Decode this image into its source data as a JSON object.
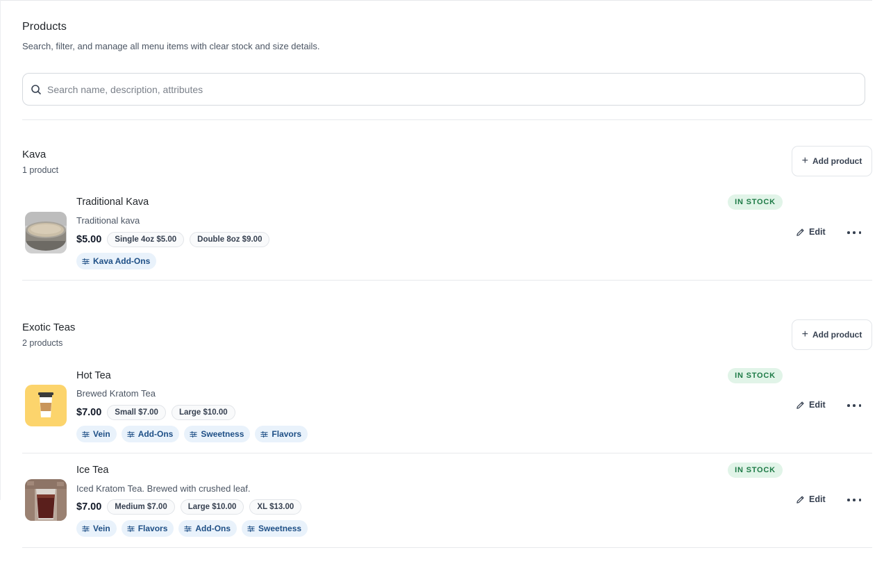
{
  "page": {
    "title": "Products",
    "subtitle": "Search, filter, and manage all menu items with clear stock and size details."
  },
  "search": {
    "placeholder": "Search name, description, attributes",
    "value": ""
  },
  "categories": [
    {
      "name": "Kava",
      "count": "1 product",
      "add_label": "Add product",
      "products": [
        {
          "name": "Traditional Kava",
          "description": "Traditional kava",
          "price": "$5.00",
          "sizes": [
            "Single 4oz $5.00",
            "Double 8oz $9.00"
          ],
          "modifiers": [
            "Kava Add-Ons"
          ],
          "stock": "IN STOCK",
          "edit_label": "Edit"
        }
      ]
    },
    {
      "name": "Exotic Teas",
      "count": "2 products",
      "add_label": "Add product",
      "products": [
        {
          "name": "Hot Tea",
          "description": "Brewed Kratom Tea",
          "price": "$7.00",
          "sizes": [
            "Small $7.00",
            "Large $10.00"
          ],
          "modifiers": [
            "Vein",
            "Add-Ons",
            "Sweetness",
            "Flavors"
          ],
          "stock": "IN STOCK",
          "edit_label": "Edit"
        },
        {
          "name": "Ice Tea",
          "description": "Iced Kratom Tea. Brewed with crushed leaf.",
          "price": "$7.00",
          "sizes": [
            "Medium $7.00",
            "Large $10.00",
            "XL $13.00"
          ],
          "modifiers": [
            "Vein",
            "Flavors",
            "Add-Ons",
            "Sweetness"
          ],
          "stock": "IN STOCK",
          "edit_label": "Edit"
        }
      ]
    }
  ],
  "colors": {
    "stock_badge_bg": "#e1f4e8",
    "stock_badge_text": "#1d7a46",
    "modifier_chip_bg": "#e9f2fb",
    "modifier_chip_text": "#1e4f86"
  },
  "icons": {
    "search": "search-icon",
    "add": "plus-icon",
    "modifier": "sliders-icon",
    "edit": "pencil-icon",
    "more": "more-horizontal-icon"
  }
}
